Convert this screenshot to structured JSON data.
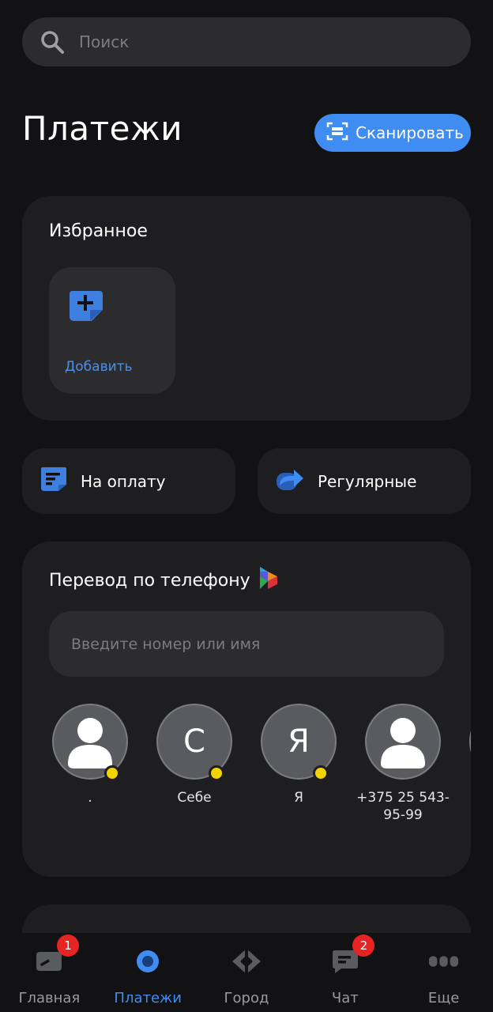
{
  "search": {
    "placeholder": "Поиск",
    "icon": "search-icon"
  },
  "header": {
    "title": "Платежи",
    "scan_label": "Сканировать"
  },
  "favorites": {
    "title": "Избранное",
    "add_label": "Добавить"
  },
  "actions": {
    "to_pay_label": "На оплату",
    "regular_label": "Регулярные"
  },
  "transfer": {
    "title": "Перевод по телефону",
    "input_placeholder": "Введите номер или имя",
    "contacts": [
      {
        "name": ".",
        "avatar": "person",
        "initial": ""
      },
      {
        "name": "Себе",
        "avatar": "letter",
        "initial": "С"
      },
      {
        "name": "Я",
        "avatar": "letter",
        "initial": "Я"
      },
      {
        "name": "+375 25 543-95-99",
        "avatar": "person",
        "initial": ""
      }
    ]
  },
  "bottom_nav": {
    "items": [
      {
        "label": "Главная",
        "icon": "home-card-icon",
        "badge": "1"
      },
      {
        "label": "Платежи",
        "icon": "payments-dot-icon",
        "badge": ""
      },
      {
        "label": "Город",
        "icon": "city-diamond-icon",
        "badge": ""
      },
      {
        "label": "Чат",
        "icon": "chat-icon",
        "badge": "2"
      },
      {
        "label": "Еще",
        "icon": "more-dots-icon",
        "badge": ""
      }
    ],
    "active_index": 1
  },
  "colors": {
    "accent": "#3f8cf2",
    "background": "#121214",
    "card": "#1e1e20",
    "status_dot": "#f2d400",
    "badge": "#e62424"
  }
}
